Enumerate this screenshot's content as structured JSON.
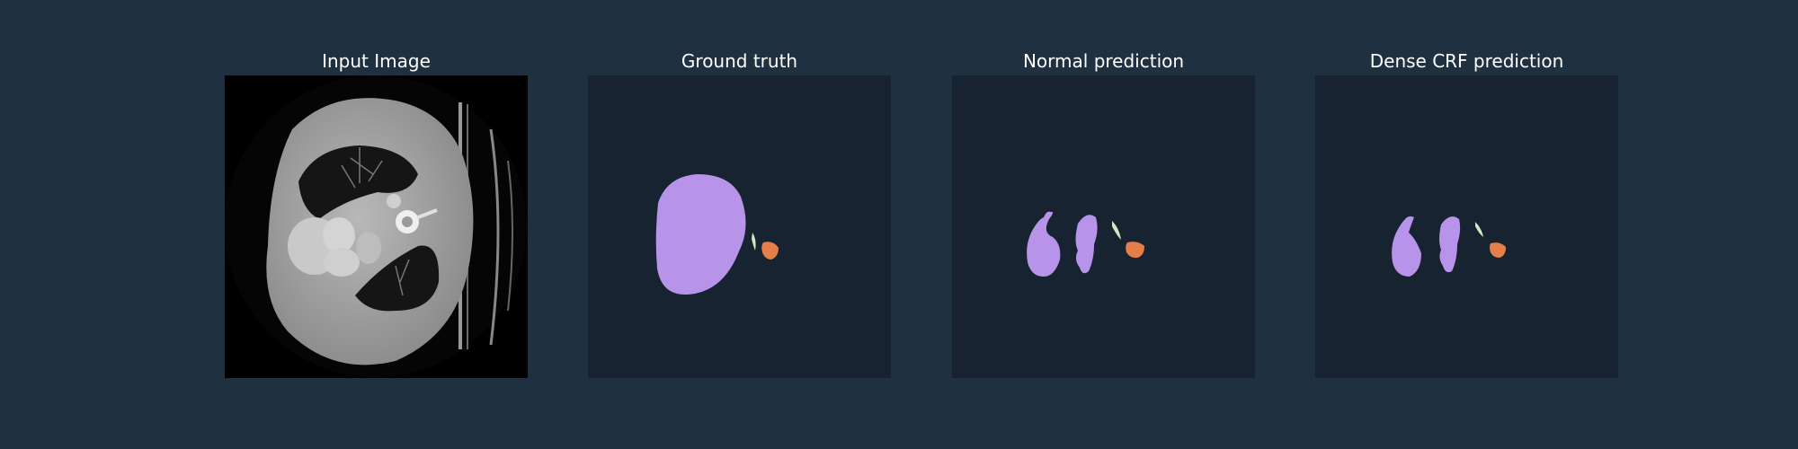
{
  "figure": {
    "background_color": "#1f3040",
    "panels": [
      {
        "title": "Input Image"
      },
      {
        "title": "Ground truth"
      },
      {
        "title": "Normal prediction"
      },
      {
        "title": "Dense CRF prediction"
      }
    ],
    "segmentation_colors": {
      "background": "#172330",
      "large_region": "#b794ea",
      "small_region": "#e67e4a",
      "thin_region": "#d2e8c0"
    }
  }
}
